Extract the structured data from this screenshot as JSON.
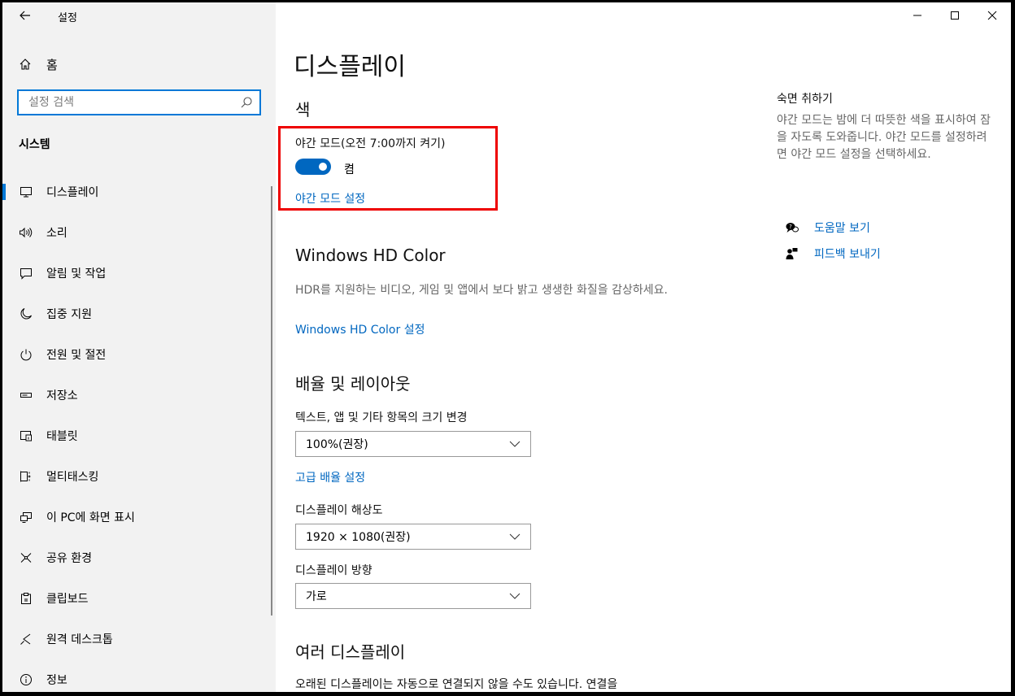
{
  "app": {
    "title": "설정"
  },
  "sidebar": {
    "home_label": "홈",
    "search_placeholder": "설정 검색",
    "section_title": "시스템",
    "items": [
      {
        "label": "디스플레이",
        "icon": "monitor-icon",
        "selected": true
      },
      {
        "label": "소리",
        "icon": "speaker-icon"
      },
      {
        "label": "알림 및 작업",
        "icon": "notification-icon"
      },
      {
        "label": "집중 지원",
        "icon": "moon-icon"
      },
      {
        "label": "전원 및 절전",
        "icon": "power-icon"
      },
      {
        "label": "저장소",
        "icon": "storage-icon"
      },
      {
        "label": "태블릿",
        "icon": "tablet-icon"
      },
      {
        "label": "멀티태스킹",
        "icon": "multitasking-icon"
      },
      {
        "label": "이 PC에 화면 표시",
        "icon": "project-icon"
      },
      {
        "label": "공유 환경",
        "icon": "share-icon"
      },
      {
        "label": "클립보드",
        "icon": "clipboard-icon"
      },
      {
        "label": "원격 데스크톱",
        "icon": "remote-desktop-icon"
      },
      {
        "label": "정보",
        "icon": "info-icon"
      }
    ]
  },
  "main": {
    "page_title": "디스플레이",
    "color_section": {
      "heading": "색",
      "night_light_label": "야간 모드(오전 7:00까지 켜기)",
      "toggle_state": "켬",
      "toggle_on": true,
      "settings_link": "야간 모드 설정"
    },
    "hdr_section": {
      "heading": "Windows HD Color",
      "description": "HDR를 지원하는 비디오, 게임 및 앱에서 보다 밝고 생생한 화질을 감상하세요.",
      "link": "Windows HD Color 설정"
    },
    "scale_section": {
      "heading": "배율 및 레이아웃",
      "scale_label": "텍스트, 앱 및 기타 항목의 크기 변경",
      "scale_value": "100%(권장)",
      "advanced_link": "고급 배율 설정",
      "resolution_label": "디스플레이 해상도",
      "resolution_value": "1920 × 1080(권장)",
      "orientation_label": "디스플레이 방향",
      "orientation_value": "가로"
    },
    "multi_display": {
      "heading": "여러 디스플레이",
      "description": "오래된 디스플레이는 자동으로 연결되지 않을 수도 있습니다. 연결을"
    }
  },
  "right_panel": {
    "title": "숙면 취하기",
    "description": "야간 모드는 밤에 더 따뜻한 색을 표시하여 잠을 자도록 도와줍니다. 야간 모드를 설정하려면 야간 모드 설정을 선택하세요.",
    "help_link": "도움말 보기",
    "feedback_link": "피드백 보내기"
  },
  "colors": {
    "accent": "#0078d7",
    "link": "#0067c0",
    "highlight": "#e00000",
    "sidebar_bg": "#f2f2f2"
  }
}
